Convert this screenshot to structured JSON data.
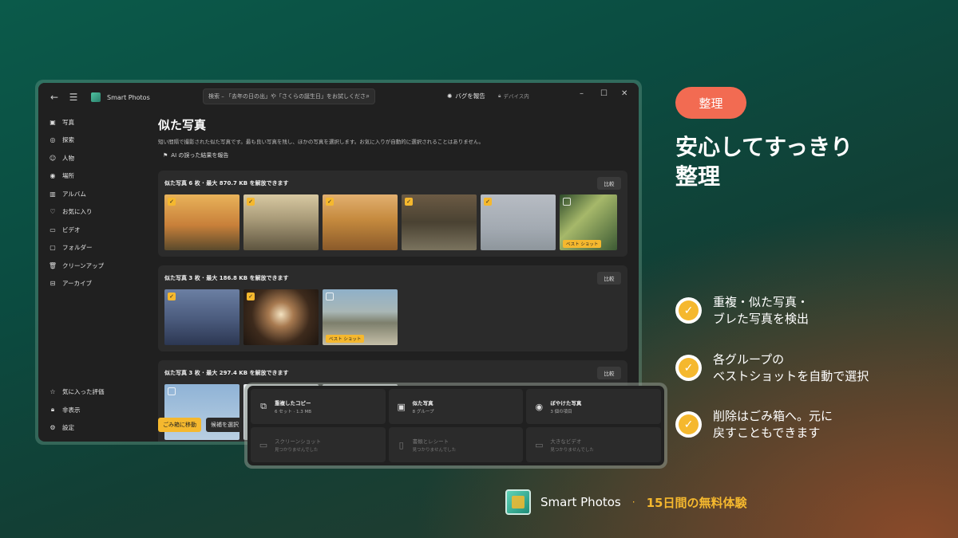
{
  "app": {
    "title": "Smart Photos",
    "search_placeholder": "検索 – 「去年の日の出」や「さくらの誕生日」をお試しください",
    "report_bug": "バグを報告",
    "device_only": "デバイス内"
  },
  "sidebar": {
    "items": [
      {
        "label": "写真",
        "icon": "photo-icon"
      },
      {
        "label": "探索",
        "icon": "explore-icon"
      },
      {
        "label": "人物",
        "icon": "people-icon"
      },
      {
        "label": "場所",
        "icon": "places-icon"
      },
      {
        "label": "アルバム",
        "icon": "album-icon"
      },
      {
        "label": "お気に入り",
        "icon": "heart-icon"
      },
      {
        "label": "ビデオ",
        "icon": "video-icon"
      },
      {
        "label": "フォルダー",
        "icon": "folder-icon"
      },
      {
        "label": "クリーンアップ",
        "icon": "trash-icon"
      },
      {
        "label": "アーカイブ",
        "icon": "archive-icon"
      }
    ],
    "bottom": [
      {
        "label": "気に入った評価",
        "icon": "star-icon"
      },
      {
        "label": "非表示",
        "icon": "lock-icon"
      },
      {
        "label": "設定",
        "icon": "gear-icon"
      }
    ]
  },
  "main": {
    "title": "似た写真",
    "subtitle": "短い間隔で撮影された似た写真です。最も良い写真を残し、ほかの写真を選択します。お気に入りが自動的に選択されることはありません。",
    "ai_report": "AI の誤った結果を報告",
    "compare_label": "比較",
    "best_label": "ベスト ショット",
    "groups": [
      {
        "title": "似た写真 6 枚 · 最大 870.7 KB を解放できます"
      },
      {
        "title": "似た写真 3 枚 · 最大 186.8 KB を解放できます"
      },
      {
        "title": "似た写真 3 枚 · 最大 297.4 KB を解放できます"
      }
    ],
    "move_to_trash": "ごみ箱に移動",
    "select_candidates": "候補を選択"
  },
  "overlay": {
    "cards": [
      {
        "title": "重複したコピー",
        "sub": "6 セット · 1.3 MB",
        "icon": "copy-icon"
      },
      {
        "title": "似た写真",
        "sub": "8 グループ",
        "icon": "image-icon"
      },
      {
        "title": "ぼやけた写真",
        "sub": "3 個の項目",
        "icon": "eye-icon"
      },
      {
        "title": "スクリーンショット",
        "sub": "見つかりませんでした",
        "icon": "monitor-icon"
      },
      {
        "title": "書類とレシート",
        "sub": "見つかりませんでした",
        "icon": "document-icon"
      },
      {
        "title": "大きなビデオ",
        "sub": "見つかりませんでした",
        "icon": "video-icon"
      }
    ]
  },
  "promo": {
    "tag": "整理",
    "headline_line1": "安心してすっきり",
    "headline_line2": "整理",
    "features": [
      {
        "line1": "重複・似た写真・",
        "line2": "ブレた写真を検出"
      },
      {
        "line1": "各グループの",
        "line2": "ベストショットを自動で選択"
      },
      {
        "line1": "削除はごみ箱へ。元に",
        "line2": "戻すこともできます"
      }
    ],
    "brand": "Smart Photos",
    "trial": "15日間の無料体験"
  },
  "colors": {
    "accent": "#f5b82e",
    "tag": "#f26b52",
    "window_bg": "#202020",
    "card_bg": "#2b2b2b"
  }
}
